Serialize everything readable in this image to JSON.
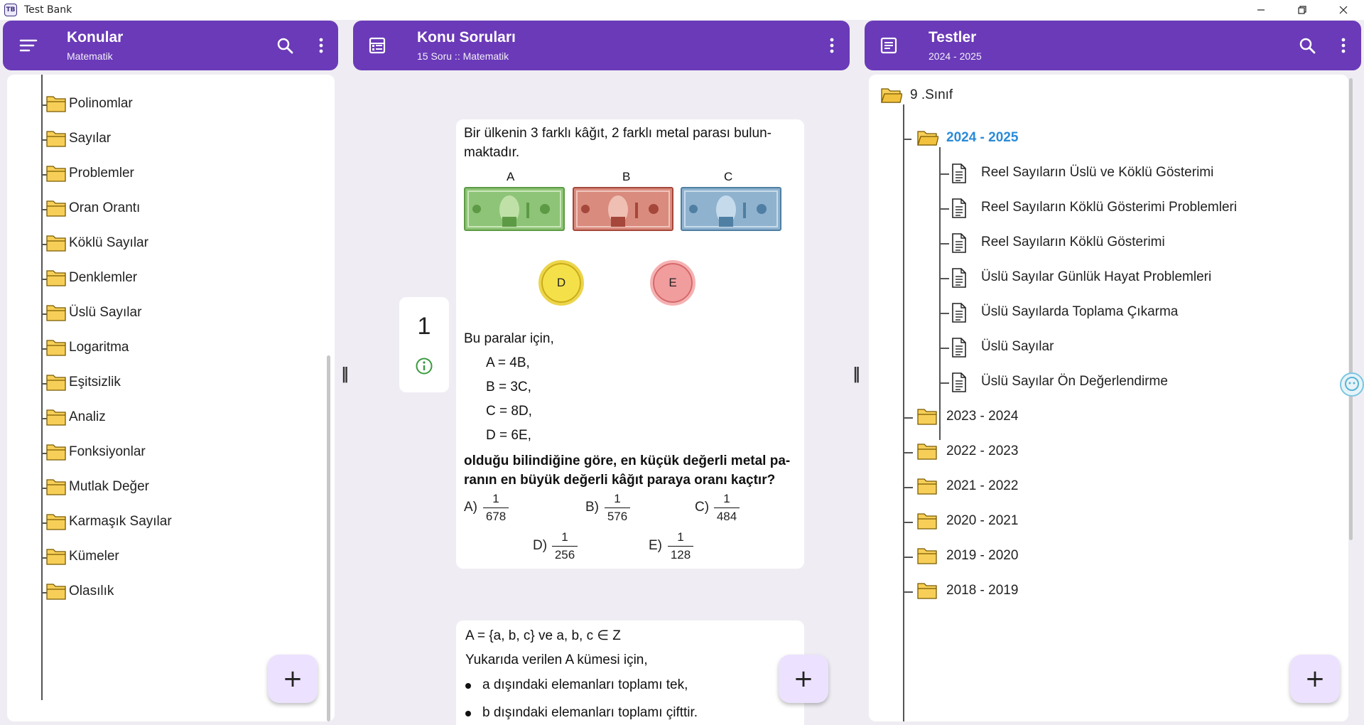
{
  "window": {
    "title": "Test Bank",
    "app_icon_text": "TB"
  },
  "colors": {
    "header": "#6a3ab8",
    "accent_blue": "#2a8bd8",
    "folder_yellow": "#f7cf58",
    "fab": "#ece2ff"
  },
  "panels": {
    "topics": {
      "title": "Konular",
      "subtitle": "Matematik",
      "items": [
        "Polinomlar",
        "Sayılar",
        "Problemler",
        "Oran Orantı",
        "Köklü Sayılar",
        "Denklemler",
        "Üslü Sayılar",
        "Logaritma",
        "Eşitsizlik",
        "Analiz",
        "Fonksiyonlar",
        "Mutlak Değer",
        "Karmaşık Sayılar",
        "Kümeler",
        "Olasılık"
      ],
      "fab_label": "+"
    },
    "questions": {
      "title": "Konu Soruları",
      "subtitle": "15 Soru :: Matematik",
      "number": "1",
      "fab_label": "+",
      "q1": {
        "line1": "Bir ülkenin 3 farklı kâğıt, 2 farklı metal parası bulun-",
        "line2": "maktadır.",
        "bill_labels": [
          "A",
          "B",
          "C"
        ],
        "coin_labels": [
          "D",
          "E"
        ],
        "intro": "Bu paralar için,",
        "equations": [
          "A = 4B,",
          "B = 3C,",
          "C = 8D,",
          "D = 6E,"
        ],
        "question_line1": "olduğu bilindiğine göre, en küçük değerli metal pa-",
        "question_line2": "ranın en büyük değerli kâğıt paraya oranı kaçtır?",
        "options": [
          {
            "label": "A)",
            "num": "1",
            "den": "678"
          },
          {
            "label": "B)",
            "num": "1",
            "den": "576"
          },
          {
            "label": "C)",
            "num": "1",
            "den": "484"
          },
          {
            "label": "D)",
            "num": "1",
            "den": "256"
          },
          {
            "label": "E)",
            "num": "1",
            "den": "128"
          }
        ]
      },
      "q2": {
        "line1": "A = {a, b, c}    ve    a, b, c  ∈ Z",
        "line2": "Yukarıda verilen A kümesi için,",
        "bullet1": "a dışındaki elemanları toplamı tek,",
        "bullet2": "b dışındaki elemanları toplamı çifttir."
      }
    },
    "tests": {
      "title": "Testler",
      "subtitle": "2024 - 2025",
      "root": "9 .Sınıf",
      "open_year": "2024 - 2025",
      "tests": [
        "Reel Sayıların Üslü ve Köklü Gösterimi",
        "Reel Sayıların Köklü Gösterimi Problemleri",
        "Reel Sayıların Köklü Gösterimi",
        "Üslü Sayılar Günlük Hayat Problemleri",
        "Üslü Sayılarda Toplama Çıkarma",
        "Üslü Sayılar",
        "Üslü Sayılar Ön Değerlendirme"
      ],
      "years": [
        "2023 - 2024",
        "2022 - 2023",
        "2021 - 2022",
        "2020 - 2021",
        "2019 - 2020",
        "2018 - 2019"
      ],
      "fab_label": "+"
    }
  }
}
